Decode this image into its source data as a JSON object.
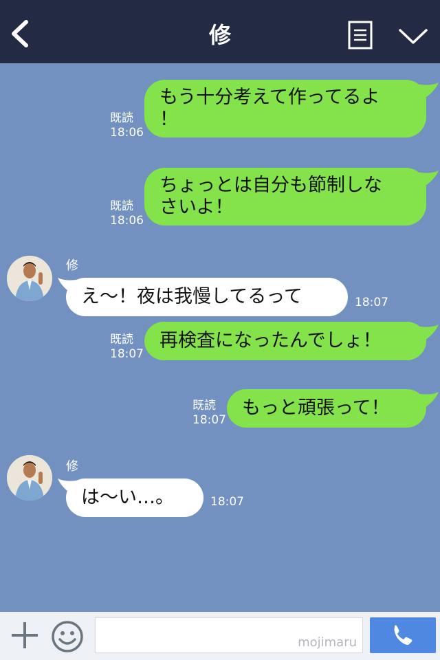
{
  "header": {
    "title": "修"
  },
  "messages": [
    {
      "type": "sent",
      "read": "既読",
      "time": "18:06",
      "text_line1": "もう十分考えて作ってるよ",
      "text_line2": "！"
    },
    {
      "type": "sent",
      "read": "既読",
      "time": "18:06",
      "text_line1": "ちょっとは自分も節制しな",
      "text_line2": "さいよ！"
    },
    {
      "type": "received",
      "sender": "修",
      "time": "18:07",
      "text": "え〜！夜は我慢してるって"
    },
    {
      "type": "sent",
      "read": "既読",
      "time": "18:07",
      "text": "再検査になったんでしょ！"
    },
    {
      "type": "sent",
      "read": "既読",
      "time": "18:07",
      "text": "もっと頑張って！"
    },
    {
      "type": "received",
      "sender": "修",
      "time": "18:07",
      "text": "は〜い…。"
    }
  ],
  "footer": {
    "watermark": "mojimaru"
  },
  "colors": {
    "header": "#222b43",
    "background": "#7290c0",
    "sent_bubble": "#84e34a",
    "received_bubble": "#ffffff",
    "call_button": "#4f88e0"
  },
  "icons": {
    "back": "chevron-left-icon",
    "menu": "document-list-icon",
    "collapse": "chevron-down-icon",
    "add": "plus-icon",
    "sticker": "smiley-icon",
    "call": "phone-icon"
  }
}
